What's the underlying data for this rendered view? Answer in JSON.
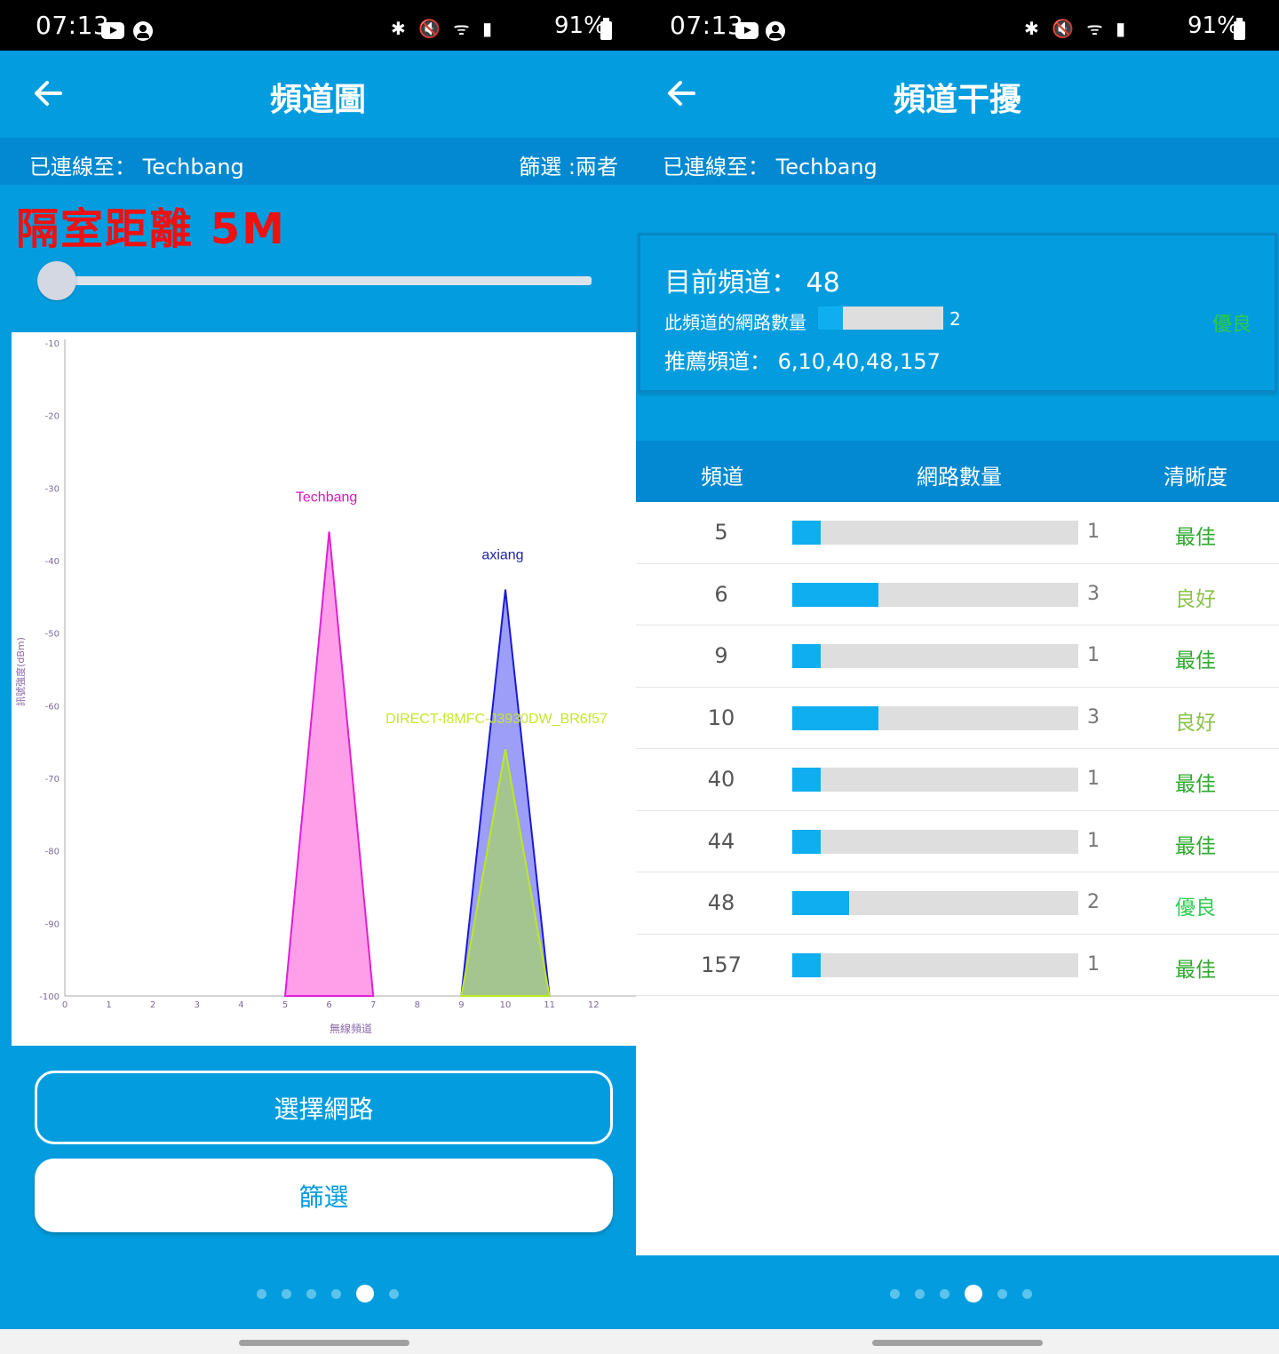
{
  "status": {
    "time": "07:13",
    "battery": "91%",
    "icons": "✱ 🔇 ᯤ ▮"
  },
  "left": {
    "title": "頻道圖",
    "connected": "已連線至： Techbang",
    "filter": "篩選 :兩者",
    "annotation": "隔室距離 5M",
    "slider_value": 0,
    "buttons": {
      "select_network": "選擇網路",
      "filter": "篩選"
    },
    "page_dots": 6,
    "active_dot": 4
  },
  "chart_data": {
    "type": "area",
    "ylabel": "訊號強度(dBm)",
    "xlabel": "無線頻道",
    "ylim": [
      -100,
      -10
    ],
    "yticks": [
      -10,
      -20,
      -30,
      -40,
      -50,
      -60,
      -70,
      -80,
      -90,
      -100
    ],
    "xlim": [
      0,
      12
    ],
    "xticks": [
      0,
      1,
      2,
      3,
      4,
      5,
      6,
      7,
      8,
      9,
      10,
      11,
      12
    ],
    "series": [
      {
        "name": "Techbang",
        "channel": 6,
        "x": [
          5,
          6,
          7
        ],
        "y": [
          -100,
          -36,
          -100
        ],
        "stroke": "#e21fd4",
        "fill": "#ff9ee9",
        "label_color": "#d41bb8"
      },
      {
        "name": "axiang",
        "channel": 10,
        "x": [
          9,
          10,
          11
        ],
        "y": [
          -100,
          -44,
          -100
        ],
        "stroke": "#1a1ad6",
        "fill": "#9d9ef7",
        "label_color": "#2222a8"
      },
      {
        "name": "DIRECT-f8MFC-J3930DW_BR6f57",
        "channel": 10,
        "x": [
          9,
          10,
          11
        ],
        "y": [
          -100,
          -66,
          -100
        ],
        "stroke": "#b9ea20",
        "fill": "#a5c590",
        "label_color": "#c4e82a"
      }
    ]
  },
  "right": {
    "title": "頻道干擾",
    "connected": "已連線至： Techbang",
    "current": {
      "label": "目前頻道： 48",
      "net_label": "此頻道的網路數量",
      "count": "2",
      "count_fraction": 0.2,
      "quality": "優良",
      "recommend": "推薦頻道： 6,10,40,48,157"
    },
    "table": {
      "headers": [
        "頻道",
        "網路數量",
        "清晰度"
      ],
      "max": 10,
      "rows": [
        {
          "channel": "5",
          "count": 1,
          "quality": "最佳",
          "color": "#2eaa2e"
        },
        {
          "channel": "6",
          "count": 3,
          "quality": "良好",
          "color": "#8bc34a"
        },
        {
          "channel": "9",
          "count": 1,
          "quality": "最佳",
          "color": "#2eaa2e"
        },
        {
          "channel": "10",
          "count": 3,
          "quality": "良好",
          "color": "#8bc34a"
        },
        {
          "channel": "40",
          "count": 1,
          "quality": "最佳",
          "color": "#2eaa2e"
        },
        {
          "channel": "44",
          "count": 1,
          "quality": "最佳",
          "color": "#2eaa2e"
        },
        {
          "channel": "48",
          "count": 2,
          "quality": "優良",
          "color": "#33cc55"
        },
        {
          "channel": "157",
          "count": 1,
          "quality": "最佳",
          "color": "#2eaa2e"
        }
      ]
    },
    "page_dots": 6,
    "active_dot": 3
  },
  "colors": {
    "primary": "#039ddf",
    "primary_dark": "#0289d1",
    "bar_fill": "#0eaef0",
    "annotation": "#ee1111"
  }
}
